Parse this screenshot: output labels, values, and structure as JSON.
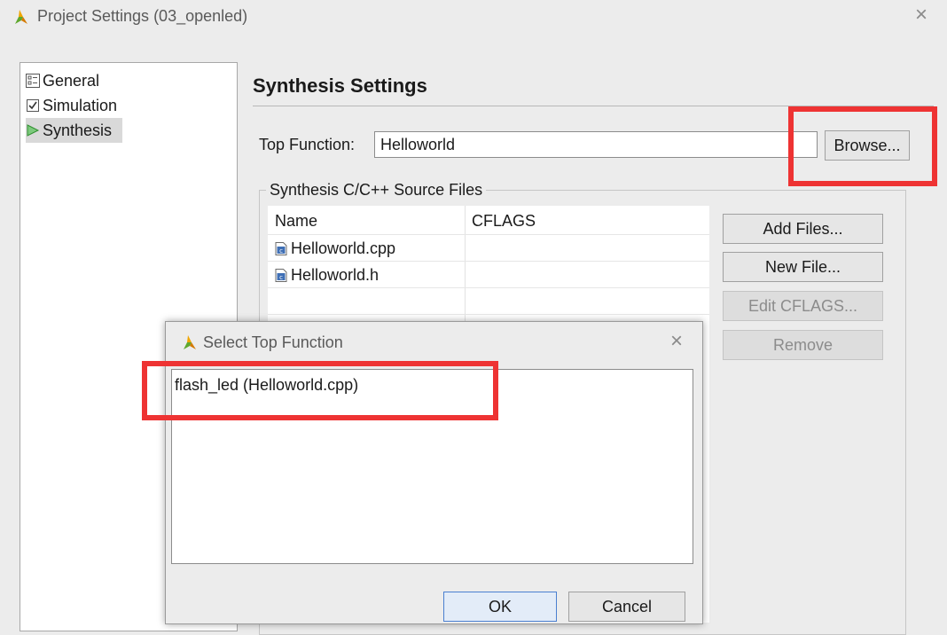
{
  "window": {
    "title": "Project Settings (03_openled)",
    "icon": "xilinx-logo-icon",
    "close_glyph": "×"
  },
  "tree": {
    "items": [
      {
        "label": "General",
        "icon": "general-settings-icon"
      },
      {
        "label": "Simulation",
        "icon": "checkbox-checked-icon"
      },
      {
        "label": "Synthesis",
        "icon": "play-triangle-icon",
        "selected": true
      }
    ]
  },
  "synthesis": {
    "title": "Synthesis Settings",
    "top_function_label": "Top Function:",
    "top_function_value": "Helloworld",
    "browse_label": "Browse...",
    "source_files_group_label": "Synthesis C/C++ Source Files",
    "columns": [
      "Name",
      "CFLAGS"
    ],
    "files": [
      {
        "name": "Helloworld.cpp",
        "cflags": "",
        "icon": "c-source-file-icon"
      },
      {
        "name": "Helloworld.h",
        "cflags": "",
        "icon": "c-source-file-icon"
      }
    ],
    "buttons": {
      "add_files": "Add Files...",
      "new_file": "New File...",
      "edit_cflags": "Edit CFLAGS...",
      "remove": "Remove"
    }
  },
  "dialog": {
    "title": "Select Top Function",
    "close_glyph": "×",
    "functions": [
      "flash_led (Helloworld.cpp)"
    ],
    "ok_label": "OK",
    "cancel_label": "Cancel"
  },
  "colors": {
    "annotation_red": "#ee3333",
    "window_bg": "#ececec",
    "selection_gray": "#d9d9d9",
    "synthesis_green": "#3aa43a"
  }
}
